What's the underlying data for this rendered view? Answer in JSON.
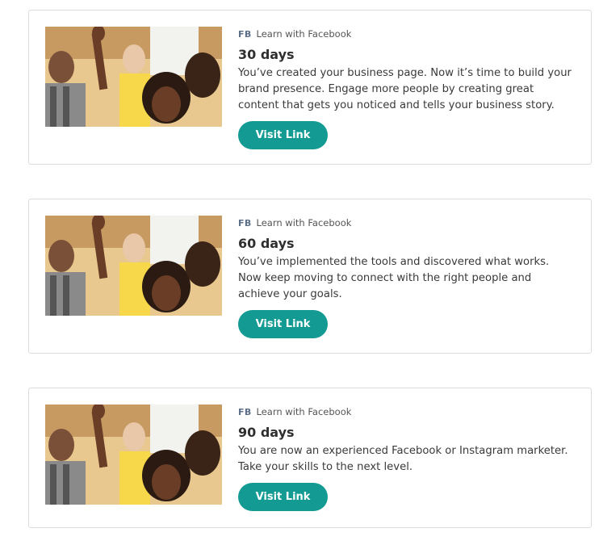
{
  "cards": [
    {
      "badge": "FB",
      "source": "Learn with Facebook",
      "title": "30 days",
      "description": "You’ve created your business page. Now it’s time to build your brand presence. Engage more people by creating great content that gets you noticed and tells your business story.",
      "button_label": "Visit Link",
      "image": "audience-raising-hand-photo"
    },
    {
      "badge": "FB",
      "source": "Learn with Facebook",
      "title": "60 days",
      "description": "You’ve implemented the tools and discovered what works. Now keep moving to connect with the right people and achieve your goals.",
      "button_label": "Visit Link",
      "image": "audience-raising-hand-photo"
    },
    {
      "badge": "FB",
      "source": "Learn with Facebook",
      "title": "90 days",
      "description": "You are now an experienced Facebook or Instagram marketer. Take your skills to the next level.",
      "button_label": "Visit Link",
      "image": "audience-raising-hand-photo"
    }
  ],
  "colors": {
    "button": "#139a93",
    "border": "#dcdcdc",
    "badge": "#5c6f87"
  }
}
